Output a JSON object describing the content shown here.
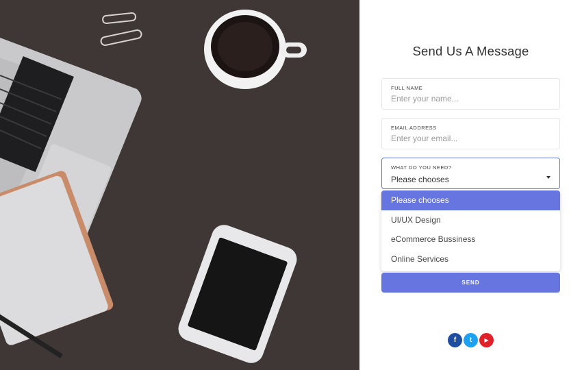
{
  "form": {
    "title": "Send Us A Message",
    "fields": [
      {
        "label": "FULL NAME",
        "placeholder": "Enter your name..."
      },
      {
        "label": "EMAIL ADDRESS",
        "placeholder": "Enter your email..."
      }
    ],
    "select": {
      "label": "WHAT DO YOU NEED?",
      "value": "Please chooses",
      "options": [
        "Please chooses",
        "UI/UX Design",
        "eCommerce Bussiness",
        "Online Services"
      ]
    },
    "send_label": "SEND"
  },
  "social": {
    "facebook": "f",
    "twitter": "t",
    "youtube": "▶"
  },
  "colors": {
    "accent": "#6675df",
    "desk": "#3e3735"
  }
}
